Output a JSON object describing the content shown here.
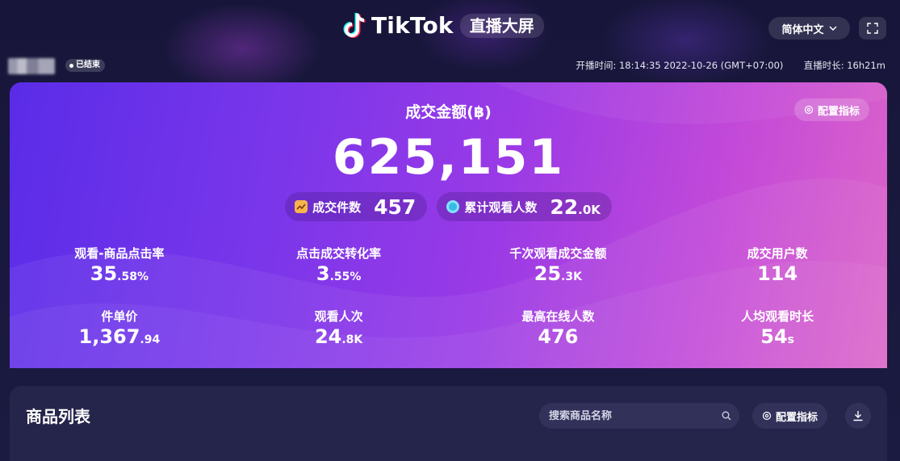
{
  "header": {
    "brand": "TikTok",
    "screen_name": "直播大屏",
    "language": "简体中文"
  },
  "subbar": {
    "status": "已结束",
    "start_label": "开播时间:",
    "start_time": "18:14:35 2022-10-26 (GMT+07:00)",
    "duration_label": "直播时长:",
    "duration": "16h21m"
  },
  "hero": {
    "title": "成交金额(฿)",
    "config_label": "配置指标",
    "gmv": "625,151",
    "pills": [
      {
        "label": "成交件数",
        "value": "457",
        "unit": ""
      },
      {
        "label": "累计观看人数",
        "value": "22",
        "unit": ".0K"
      }
    ],
    "metrics": [
      {
        "label": "观看-商品点击率",
        "value": "35",
        "unit": ".58%"
      },
      {
        "label": "点击成交转化率",
        "value": "3",
        "unit": ".55%"
      },
      {
        "label": "千次观看成交金额",
        "value": "25",
        "unit": ".3K"
      },
      {
        "label": "成交用户数",
        "value": "114",
        "unit": ""
      },
      {
        "label": "件单价",
        "value": "1,367",
        "unit": ".94"
      },
      {
        "label": "观看人次",
        "value": "24",
        "unit": ".8K"
      },
      {
        "label": "最高在线人数",
        "value": "476",
        "unit": ""
      },
      {
        "label": "人均观看时长",
        "value": "54",
        "unit": "s"
      }
    ]
  },
  "products": {
    "title": "商品列表",
    "search_placeholder": "搜索商品名称",
    "config_label": "配置指标"
  },
  "colors": {
    "page_bg": "#1a1a3a",
    "hero_start": "#5a2ce8",
    "hero_end": "#dc64c8",
    "panel_bg": "#25244a"
  }
}
